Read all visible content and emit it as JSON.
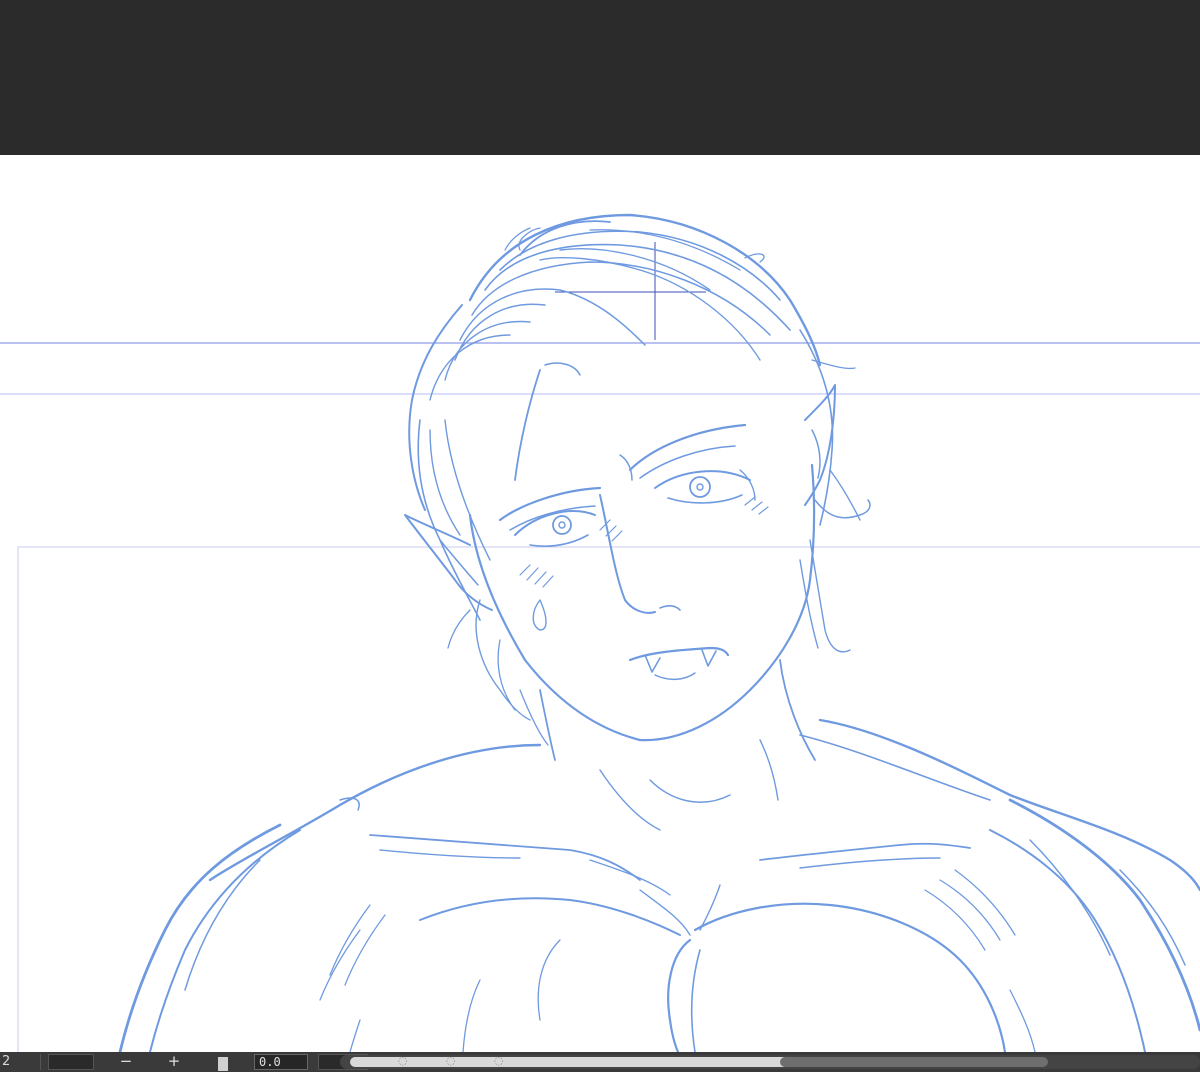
{
  "app": {
    "colors": {
      "toolbar": "#2b2b2b",
      "canvas": "#ffffff",
      "sketch_stroke": "#6f9ae0",
      "guide_line": "#a9b3f0",
      "frame_border": "#c9cdf2",
      "status_bar": "#3a3a3a"
    }
  },
  "statusbar": {
    "zoom_value": "2",
    "zoom_out_label": "−",
    "zoom_in_label": "+",
    "angle_value": "0.0",
    "icons": [
      "zoom-out-icon",
      "zoom-in-icon",
      "rotate-left-icon",
      "rotate-reset-icon",
      "rotate-right-icon"
    ]
  }
}
